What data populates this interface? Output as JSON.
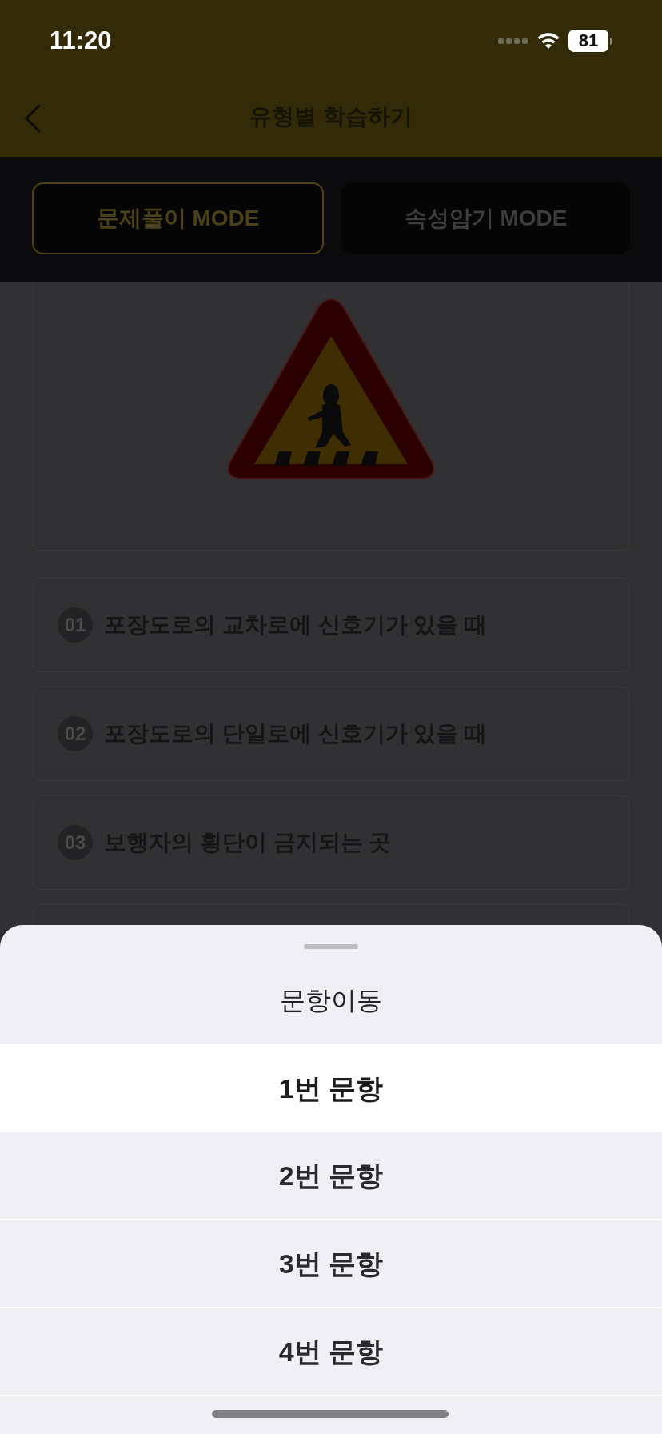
{
  "status_bar": {
    "time": "11:20",
    "battery": "81"
  },
  "header": {
    "title": "유형별 학습하기"
  },
  "mode_tabs": [
    {
      "label": "문제풀이 MODE",
      "selected": true
    },
    {
      "label": "속성암기 MODE",
      "selected": false
    }
  ],
  "options": [
    {
      "number": "01",
      "text": "포장도로의 교차로에 신호기가 있을 때"
    },
    {
      "number": "02",
      "text": "포장도로의 단일로에 신호기가 있을 때"
    },
    {
      "number": "03",
      "text": "보행자의 횡단이 금지되는 곳"
    }
  ],
  "sheet": {
    "title": "문항이동",
    "items": [
      {
        "label": "1번 문항",
        "selected": true
      },
      {
        "label": "2번 문항",
        "selected": false
      },
      {
        "label": "3번 문항",
        "selected": false
      },
      {
        "label": "4번 문항",
        "selected": false
      }
    ]
  }
}
